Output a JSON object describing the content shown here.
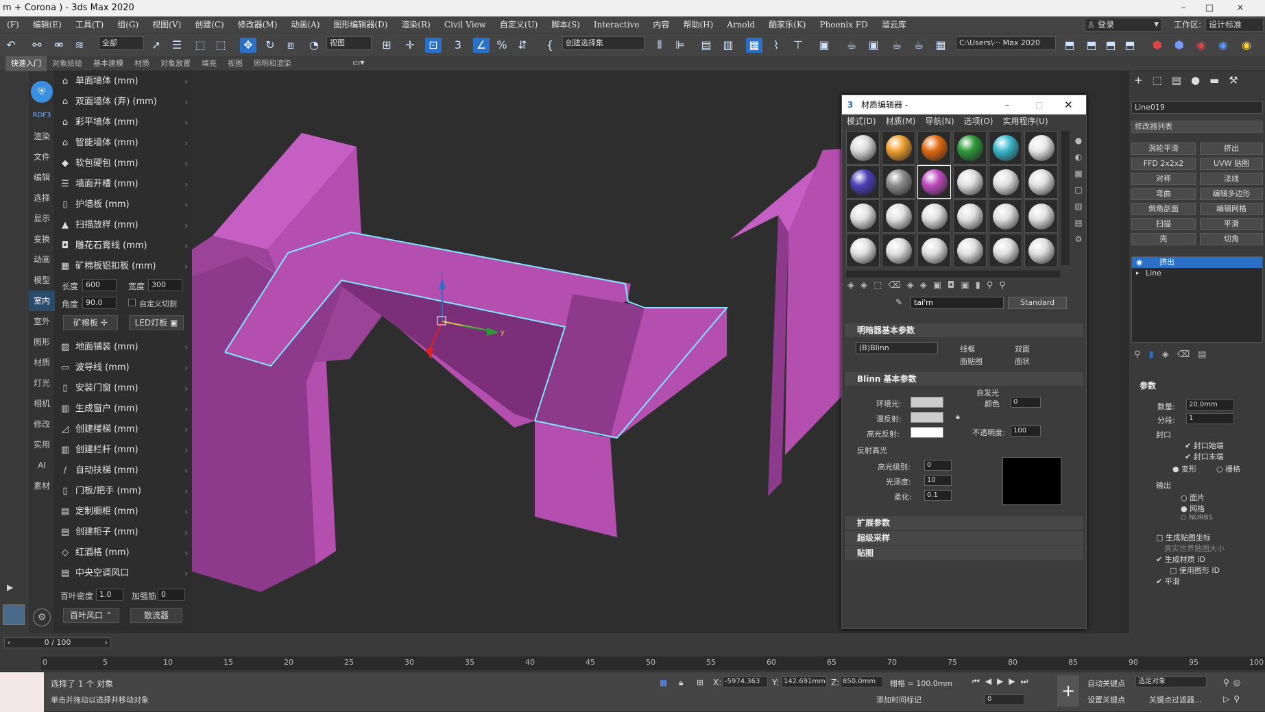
{
  "window": {
    "title": "m + Corona ) - 3ds Max 2020",
    "controls": [
      "–",
      "□",
      "×"
    ]
  },
  "menu": [
    "(F)",
    "编辑(E)",
    "工具(T)",
    "组(G)",
    "视图(V)",
    "创建(C)",
    "修改器(M)",
    "动画(A)",
    "图形编辑器(D)",
    "渲染(R)",
    "Civil View",
    "自定义(U)",
    "脚本(S)",
    "Interactive",
    "内容",
    "帮助(H)",
    "Arnold",
    "酷家乐(K)",
    "Phoenix FD",
    "溜云库"
  ],
  "login": "登录",
  "workspace": {
    "label": "工作区:",
    "value": "设计标准"
  },
  "toolbar": {
    "filter": "全部",
    "refcoord": "视图",
    "selection_set": "创建选择集",
    "path": "C:\\Users\\··· Max 2020"
  },
  "ribbon_tabs": [
    "快速入门",
    "对象绘绘",
    "基本建模",
    "材质",
    "对象放置",
    "填充",
    "视图",
    "照明和渲染"
  ],
  "left_categories": [
    "RDF3",
    "渲染",
    "文件",
    "编辑",
    "选择",
    "显示",
    "变换",
    "动画",
    "模型",
    "室内",
    "室外",
    "图形",
    "材质",
    "灯光",
    "相机",
    "修改",
    "实用",
    "AI",
    "素材"
  ],
  "active_category": "室内",
  "commands_a": [
    {
      "icon": "⌂",
      "label": "单面墙体 (mm)"
    },
    {
      "icon": "⌂",
      "label": "双面墙体 (弃) (mm)"
    },
    {
      "icon": "⌂",
      "label": "彩平墙体 (mm)"
    },
    {
      "icon": "⌂",
      "label": "智能墙体 (mm)"
    },
    {
      "icon": "◆",
      "label": "软包硬包 (mm)"
    },
    {
      "icon": "☰",
      "label": "墙面开槽 (mm)"
    },
    {
      "icon": "▯",
      "label": "护墙板 (mm)"
    },
    {
      "icon": "▲",
      "label": "扫描放样 (mm)"
    },
    {
      "icon": "◘",
      "label": "雕花石膏线 (mm)"
    },
    {
      "icon": "▦",
      "label": "矿棉板铝扣板 (mm)"
    }
  ],
  "params_a": {
    "length_label": "长度",
    "length": "600",
    "width_label": "宽度",
    "width": "300",
    "angle_label": "角度",
    "angle": "90.0",
    "custom_cut": "自定义切割",
    "btn1": "矿棉板",
    "btn2": "LED灯板"
  },
  "commands_b": [
    {
      "icon": "▨",
      "label": "地面铺装 (mm)"
    },
    {
      "icon": "▭",
      "label": "波导线 (mm)"
    },
    {
      "icon": "▯",
      "label": "安装门窗 (mm)"
    },
    {
      "icon": "▥",
      "label": "生成窗户 (mm)"
    },
    {
      "icon": "◿",
      "label": "创建楼梯 (mm)"
    },
    {
      "icon": "▥",
      "label": "创建栏杆 (mm)"
    },
    {
      "icon": "∕",
      "label": "自动扶梯 (mm)"
    },
    {
      "icon": "▯",
      "label": "门板/把手 (mm)"
    },
    {
      "icon": "▤",
      "label": "定制橱柜 (mm)"
    },
    {
      "icon": "▤",
      "label": "创建柜子 (mm)"
    },
    {
      "icon": "◇",
      "label": "红酒格 (mm)"
    },
    {
      "icon": "▤",
      "label": "中央空调风口"
    }
  ],
  "params_b": {
    "density_label": "百叶密度",
    "density": "1.0",
    "rib_label": "加强筋",
    "rib": "0",
    "btn1": "百叶风口",
    "btn2": "散流器"
  },
  "gizmo": {
    "z": "z",
    "y": "y"
  },
  "colors": {
    "object": "#b44fb0",
    "object_dark": "#8e3a8c",
    "object_light": "#c65fc3",
    "selection": "#7ee8ff",
    "accent": "#2a6fc8"
  },
  "material_editor": {
    "title": "材质编辑器 -",
    "menu": [
      "模式(D)",
      "材质(M)",
      "导航(N)",
      "选项(O)",
      "实用程序(U)"
    ],
    "slot_colors": [
      "#d9d9d9",
      "#f0a030",
      "#e26a10",
      "#2e9a3a",
      "#3ab8cc",
      "#e8e8e8",
      "#4a3fb8",
      "#8c8c8c",
      "#c04bc0",
      "#e0e0e0",
      "#e0e0e0",
      "#e0e0e0",
      "#e0e0e0",
      "#e0e0e0",
      "#e0e0e0",
      "#e0e0e0",
      "#e0e0e0",
      "#e0e0e0",
      "#e0e0e0",
      "#e0e0e0",
      "#e0e0e0",
      "#e0e0e0",
      "#e0e0e0",
      "#e0e0e0"
    ],
    "material_name": "tai'm",
    "material_type": "Standard",
    "shader_rollout": "明暗器基本参数",
    "shader": "(B)Blinn",
    "wire": "线框",
    "two_sided": "双面",
    "face_map": "面贴图",
    "faceted": "面状",
    "blinn_rollout": "Blinn 基本参数",
    "self_illum": "自发光",
    "color_label": "颜色",
    "color_value": "0",
    "ambient": "环境光:",
    "diffuse": "漫反射:",
    "specular": "高光反射:",
    "opacity_label": "不透明度:",
    "opacity": "100",
    "spec_highlights": "反射高光",
    "spec_level_label": "高光级别:",
    "spec_level": "0",
    "gloss_label": "光泽度:",
    "gloss": "10",
    "soften_label": "柔化:",
    "soften": "0.1",
    "rollouts": [
      "扩展参数",
      "超级采样",
      "贴图"
    ]
  },
  "right_panel": {
    "object_name": "Line019",
    "modifier_list": "修改器列表",
    "mod_buttons": [
      "涡轮平滑",
      "挤出",
      "FFD 2x2x2",
      "UVW 贴图",
      "对称",
      "法线",
      "弯曲",
      "编辑多边形",
      "倒角剖面",
      "编辑网格",
      "扫描",
      "平滑",
      "壳",
      "切角"
    ],
    "stack": [
      "挤出",
      "Line"
    ],
    "params_title": "参数",
    "amount_label": "数量:",
    "amount": "20.0mm",
    "segments_label": "分段:",
    "segments": "1",
    "capping": "封口",
    "cap_start": "封口始端",
    "cap_end": "封口末端",
    "morph": "变形",
    "grid": "栅格",
    "output": "输出",
    "patch": "面片",
    "mesh": "网格",
    "nurbs": "NURBS",
    "gen_map": "生成贴图坐标",
    "real_world": "真实世界贴图大小",
    "gen_mat": "生成材质 ID",
    "use_shape": "使用图形 ID",
    "smooth": "平滑"
  },
  "timeline": {
    "frame": "0 / 100",
    "ticks": [
      "0",
      "5",
      "10",
      "15",
      "20",
      "25",
      "30",
      "35",
      "40",
      "45",
      "50",
      "55",
      "60",
      "65",
      "70",
      "75",
      "80",
      "85",
      "90",
      "95",
      "100"
    ]
  },
  "status": {
    "selected": "选择了 1 个 对象",
    "hint": "单击并拖动以选择并移动对象",
    "x_label": "X:",
    "x": "-5974.363",
    "y_label": "Y:",
    "y": "142.691mm",
    "z_label": "Z:",
    "z": "850.0mm",
    "grid": "栅格 = 100.0mm",
    "add_time_tag": "添加时间标记",
    "auto_key": "自动关键点",
    "selected_obj": "选定对象",
    "set_key": "设置关键点",
    "key_filters": "关键点过滤器...",
    "frame_field": "0"
  }
}
